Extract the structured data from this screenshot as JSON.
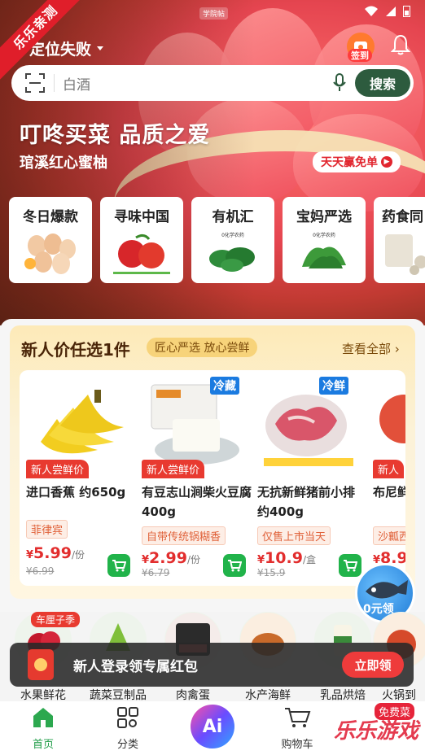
{
  "status": {
    "center_label": "学院帖"
  },
  "watermark": {
    "ribbon": "乐乐亲测",
    "brand": "乐乐游戏",
    "url": ""
  },
  "header": {
    "location": "定位失败",
    "checkin_label": "签到",
    "search_placeholder": "白酒",
    "search_button": "搜索"
  },
  "hero": {
    "slogan": "叮咚买菜 品质之爱",
    "subtitle": "琯溪红心蜜柚",
    "promo": "天天赢免单"
  },
  "categories": [
    {
      "label": "冬日爆款",
      "icon": "eggs-image"
    },
    {
      "label": "寻味中国",
      "icon": "apples-image"
    },
    {
      "label": "有机汇",
      "icon": "spinach-image"
    },
    {
      "label": "宝妈严选",
      "icon": "greens-image"
    },
    {
      "label": "药食同",
      "icon": "herbs-image"
    }
  ],
  "new_user": {
    "title": "新人价任选1件",
    "tag": "匠心严选 放心尝鲜",
    "view_all": "查看全部",
    "products": [
      {
        "name": "进口香蕉 约650g",
        "ribbon": "新人尝鲜价",
        "note": "菲律宾",
        "price": "5.99",
        "unit": "/份",
        "orig": "¥6.99",
        "cold": ""
      },
      {
        "name": "有豆志山涧柴火豆腐 400g",
        "ribbon": "新人尝鲜价",
        "note": "自带传统锅糊香",
        "price": "2.99",
        "unit": "/份",
        "orig": "¥6.79",
        "cold": "冷藏"
      },
      {
        "name": "无抗新鲜猪前小排 约400g",
        "ribbon": "",
        "note": "仅售上市当天",
        "price": "10.9",
        "unit": "/盒",
        "orig": "¥15.9",
        "cold": "冷鲜"
      },
      {
        "name": "布尼鲜茄 约",
        "ribbon": "新人",
        "note": "沙瓤西",
        "price": "8.9",
        "unit": "",
        "orig": "",
        "cold": ""
      }
    ],
    "fish_label": "0元领"
  },
  "categories2": [
    {
      "label": "水果鲜花"
    },
    {
      "label": "蔬菜豆制品"
    },
    {
      "label": "肉禽蛋"
    },
    {
      "label": "水产海鲜"
    },
    {
      "label": "乳品烘焙"
    },
    {
      "label": "火锅到"
    }
  ],
  "categories2_badge": "车厘子季",
  "toast": {
    "text": "新人登录领专属红包",
    "button": "立即领"
  },
  "tabbar": {
    "home": "首页",
    "category": "分类",
    "ai": "Ai",
    "cart": "购物车",
    "free_badge": "免费菜"
  },
  "colors": {
    "brand_green": "#2d5b3e",
    "price_red": "#e22d2d",
    "cart_green": "#21b34a"
  }
}
